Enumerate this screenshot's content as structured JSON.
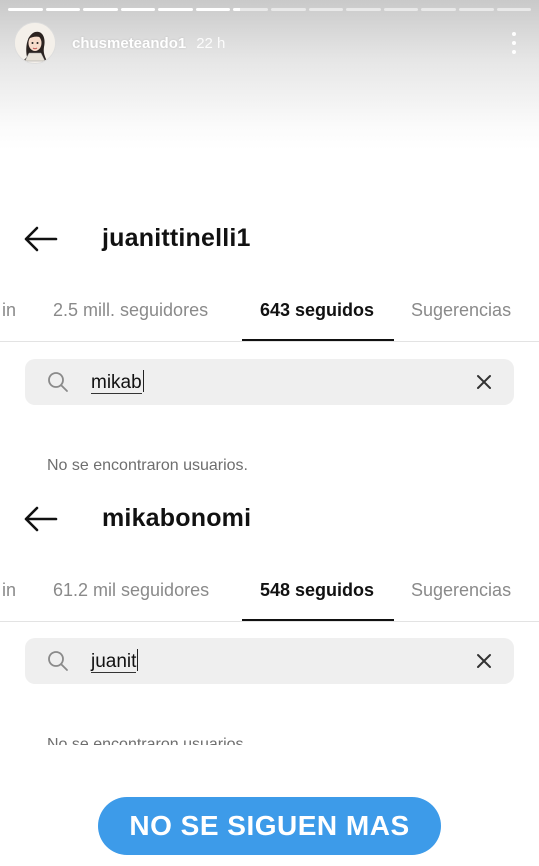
{
  "story": {
    "username": "chusmeteando1",
    "time": "22 h",
    "segments_total": 14,
    "segments_done": 6,
    "icons": {
      "avatar": "avatar-illustration",
      "more": "more-vertical-icon"
    }
  },
  "screens": [
    {
      "profile_name": "juanittinelli1",
      "tabs": [
        "in",
        "2.5 mill. seguidores",
        "643 seguidos",
        "Sugerencias"
      ],
      "active_tab": 2,
      "search_value": "mikab",
      "empty_message": "No se encontraron usuarios."
    },
    {
      "profile_name": "mikabonomi",
      "tabs": [
        "in",
        "61.2 mil seguidores",
        "548 seguidos",
        "Sugerencias"
      ],
      "active_tab": 2,
      "search_value": "juanit",
      "empty_message": "No se encontraron usuarios"
    }
  ],
  "cta": {
    "label": "NO SE SIGUEN MAS",
    "color": "#3d9be9"
  }
}
